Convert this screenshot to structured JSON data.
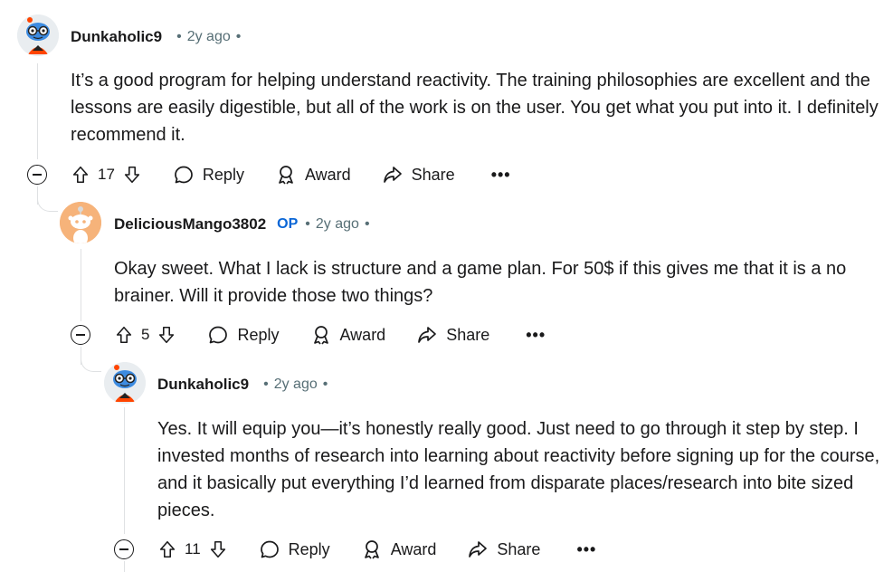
{
  "comments": [
    {
      "username": "Dunkaholic9",
      "time": "2y ago",
      "body": "It’s a good program for helping understand reactivity. The training philosophies are excellent and the lessons are easily digestible, but all of the work is on the user. You get what you put into it. I definitely recommend it.",
      "score": "17",
      "reply": "Reply",
      "award": "Award",
      "share": "Share",
      "more": "•••"
    },
    {
      "username": "DeliciousMango3802",
      "op_badge": "OP",
      "time": "2y ago",
      "body": "Okay sweet. What I lack is structure and a game plan. For 50$ if this gives me that it is a no brainer. Will it provide those two things?",
      "score": "5",
      "reply": "Reply",
      "award": "Award",
      "share": "Share",
      "more": "•••"
    },
    {
      "username": "Dunkaholic9",
      "time": "2y ago",
      "body": "Yes. It will equip you—it’s honestly really good. Just need to go through it step by step. I invested months of research into learning about reactivity before signing up for the course, and it basically put everything I’d learned from disparate places/research into bite sized pieces.",
      "score": "11",
      "reply": "Reply",
      "award": "Award",
      "share": "Share",
      "more": "•••"
    }
  ],
  "colors": {
    "op": "#0a66d6",
    "meta": "#576f76",
    "thread": "#dfe1e3"
  }
}
